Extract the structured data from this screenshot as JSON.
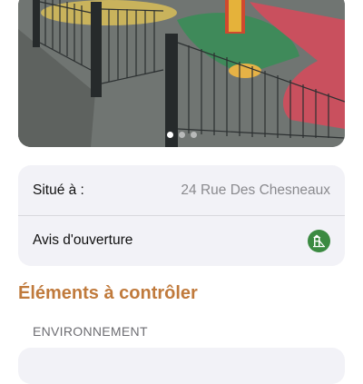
{
  "photo": {
    "carousel": {
      "page_count": 3,
      "active_index": 0
    }
  },
  "info": {
    "location_label": "Situé à :",
    "location_value": "24 Rue Des Chesneaux",
    "opening_label": "Avis d'ouverture",
    "opening_icon": "playground-icon"
  },
  "section": {
    "title": "Éléments à contrôler",
    "subtitle": "ENVIRONNEMENT"
  },
  "colors": {
    "accent": "#c07a3c",
    "status_green": "#3b8a41",
    "card_bg": "#f2f2f7"
  }
}
